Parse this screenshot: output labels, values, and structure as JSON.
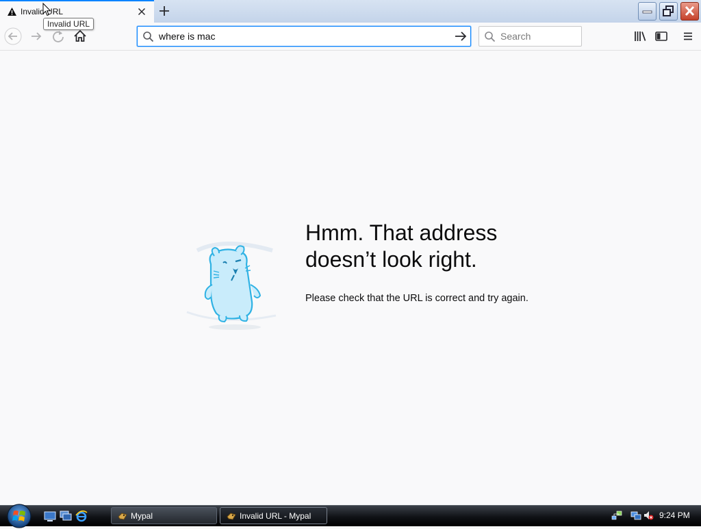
{
  "tab": {
    "title": "Invalid URL",
    "tooltip": "Invalid URL"
  },
  "navbar": {
    "url_value": "where is mac",
    "search_placeholder": "Search"
  },
  "error": {
    "title": "Hmm. That address doesn’t look right.",
    "description": "Please check that the URL is correct and try again."
  },
  "taskbar": {
    "tasks": [
      {
        "label": "Mypal"
      },
      {
        "label": "Invalid URL - Mypal"
      }
    ],
    "clock": "9:24 PM"
  },
  "colors": {
    "accent": "#0a84ff",
    "page_bg": "#f9f9fa"
  },
  "icons": {
    "back": "arrow-left-icon",
    "forward": "arrow-right-icon",
    "reload": "reload-icon",
    "home": "home-icon",
    "library": "library-icon",
    "sidebar": "sidebar-icon",
    "menu": "hamburger-menu-icon"
  }
}
